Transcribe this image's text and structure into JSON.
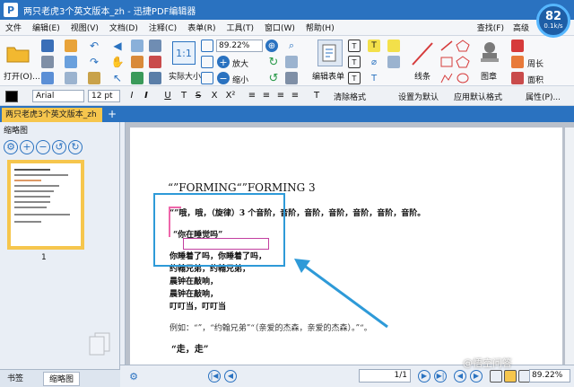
{
  "window": {
    "title": "两只老虎3个英文版本_zh - 迅捷PDF编辑器",
    "logo_letter": "P",
    "perf_value": "82",
    "perf_speed": "0.1k/s"
  },
  "menu": {
    "items": [
      "文件",
      "编辑(E)",
      "视图(V)",
      "文档(D)",
      "注释(C)",
      "表单(R)",
      "工具(T)",
      "窗口(W)",
      "帮助(H)"
    ],
    "right_items": [
      "查找(F)",
      "高级"
    ]
  },
  "ribbon": {
    "open_label": "打开(O)...",
    "actual_size_label": "实际大小",
    "zoom_value": "89.22%",
    "zoom_in_label": "放大",
    "zoom_out_label": "缩小",
    "edit_form_label": "编辑表单",
    "line_label": "线条",
    "stamp_label": "图章",
    "perimeter_label": "周长",
    "area_label": "面积"
  },
  "format": {
    "font": "Arial",
    "size": "12 pt",
    "clear_format_label": "清除格式",
    "set_default_label": "设置为默认",
    "apply_default_label": "应用默认格式",
    "properties_label": "属性(P)..."
  },
  "tabs": {
    "doc_tab": "两只老虎3个英文版本_zh *",
    "new_tab": "+"
  },
  "left_panel": {
    "header": "缩略图",
    "page_number": "1",
    "tab_bookmarks": "书签",
    "tab_thumbnails": "缩略图"
  },
  "document": {
    "heading": "“”FORMING“”FORMING 3",
    "line1": "“”哦，哦，（旋律）3 个音阶，音阶，音阶，音阶，音阶，音阶，音阶。",
    "line2": "“你在睡觉吗”",
    "line3": "你睡着了吗，你睡着了吗，",
    "line4": "约翰兄弟，约翰兄弟，",
    "line5": "晨钟在敲响，",
    "line6": "晨钟在敲响，",
    "line7": "叮叮当，叮叮当",
    "line8": "例如：“”，“约翰兄弟”“（亲爱的杰森，亲爱的杰森）。”“。",
    "line9": "“走，走”"
  },
  "status": {
    "page_indicator": "1/1",
    "zoom_value": "89.22%"
  },
  "watermark": "@悟空问答"
}
